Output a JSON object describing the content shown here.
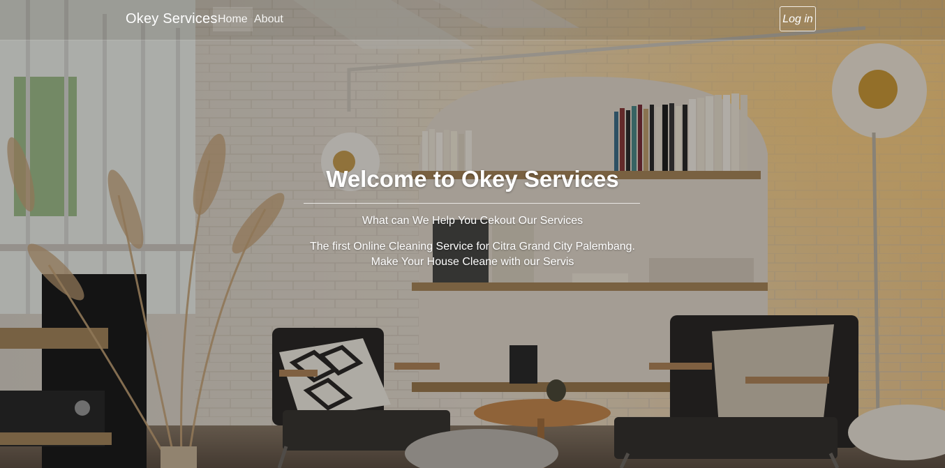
{
  "navbar": {
    "brand": "Okey Services",
    "links": [
      {
        "label": "Home"
      },
      {
        "label": "About"
      }
    ],
    "login_label": "Log in"
  },
  "hero": {
    "title": "Welcome to Okey Services",
    "subtitle": "What can We Help You Cekout Our Services",
    "description": "The first Online Cleaning Service for Citra Grand City Palembang. Make Your House Cleane with our Servis"
  }
}
